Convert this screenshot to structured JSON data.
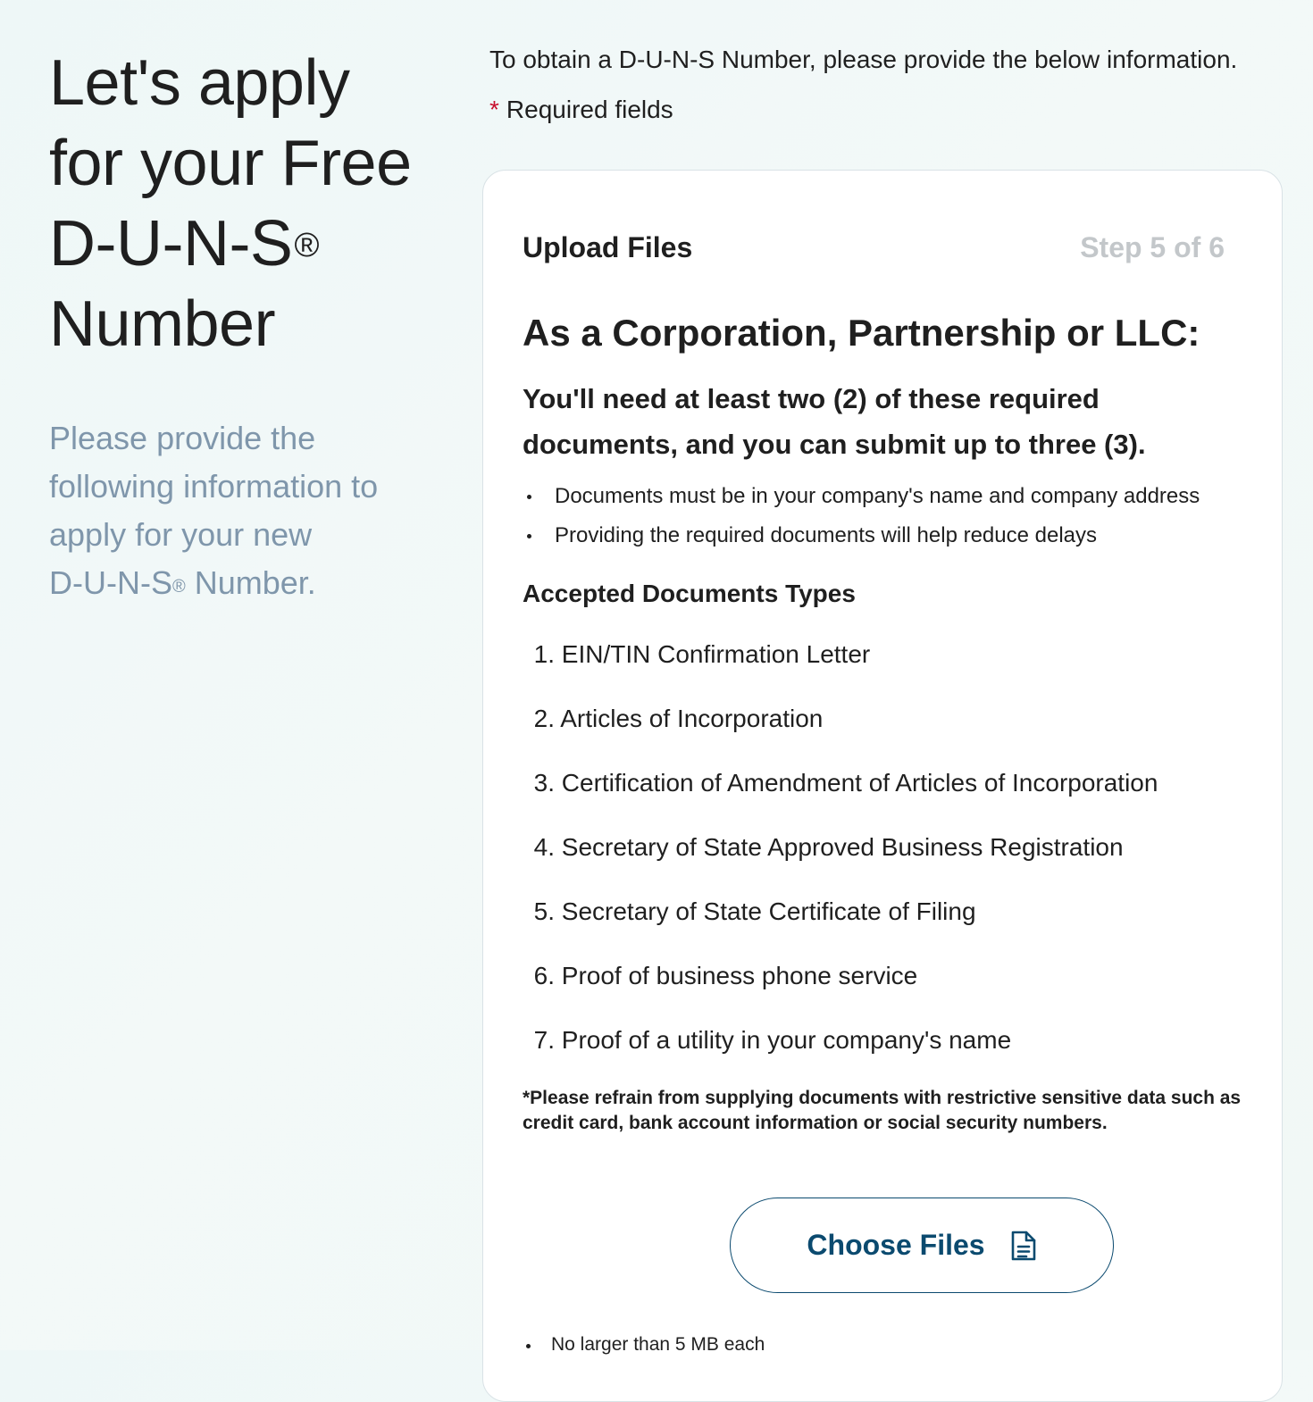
{
  "hero": {
    "title_lines": [
      "Let's apply",
      "for your Free",
      "D-U-N-S",
      "Number"
    ],
    "title_mark": "®",
    "subtitle_lines": [
      "Please provide the",
      "following information to",
      "apply for your new",
      "D-U-N-S",
      " Number."
    ],
    "subtitle_mark": "®"
  },
  "intro": {
    "text": "To obtain a D-U-N-S Number, please provide the below information.",
    "required_asterisk": "*",
    "required_label": "Required fields"
  },
  "card": {
    "title": "Upload Files",
    "step": "Step 5 of 6",
    "section_heading": "As a Corporation, Partnership or LLC:",
    "requirement": "You'll need at least two (2) of these required documents, and you can submit up to three (3).",
    "bullets": [
      "Documents must be in your company's name and company address",
      "Providing the required documents will help reduce delays"
    ],
    "accepted_heading": "Accepted Documents Types",
    "documents": [
      {
        "num": "1.",
        "label": "EIN/TIN Confirmation Letter"
      },
      {
        "num": "2.",
        "label": "Articles of Incorporation"
      },
      {
        "num": "3.",
        "label": "Certification of Amendment of Articles of Incorporation"
      },
      {
        "num": "4.",
        "label": "Secretary of State Approved Business Registration"
      },
      {
        "num": "5.",
        "label": "Secretary of State Certificate of Filing"
      },
      {
        "num": "6.",
        "label": "Proof of business phone service"
      },
      {
        "num": "7.",
        "label": "Proof of a utility in your company's name"
      }
    ],
    "disclaimer": "*Please refrain from supplying documents with restrictive sensitive data such as credit card, bank account information or social security numbers.",
    "choose_files_label": "Choose Files",
    "choose_files_icon": "document-icon",
    "file_notes": [
      "No larger than 5 MB each"
    ]
  },
  "colors": {
    "accent": "#0b4a6f",
    "required": "#c8102e",
    "subtitle": "#7f96ab",
    "step": "#c3c7ca"
  }
}
